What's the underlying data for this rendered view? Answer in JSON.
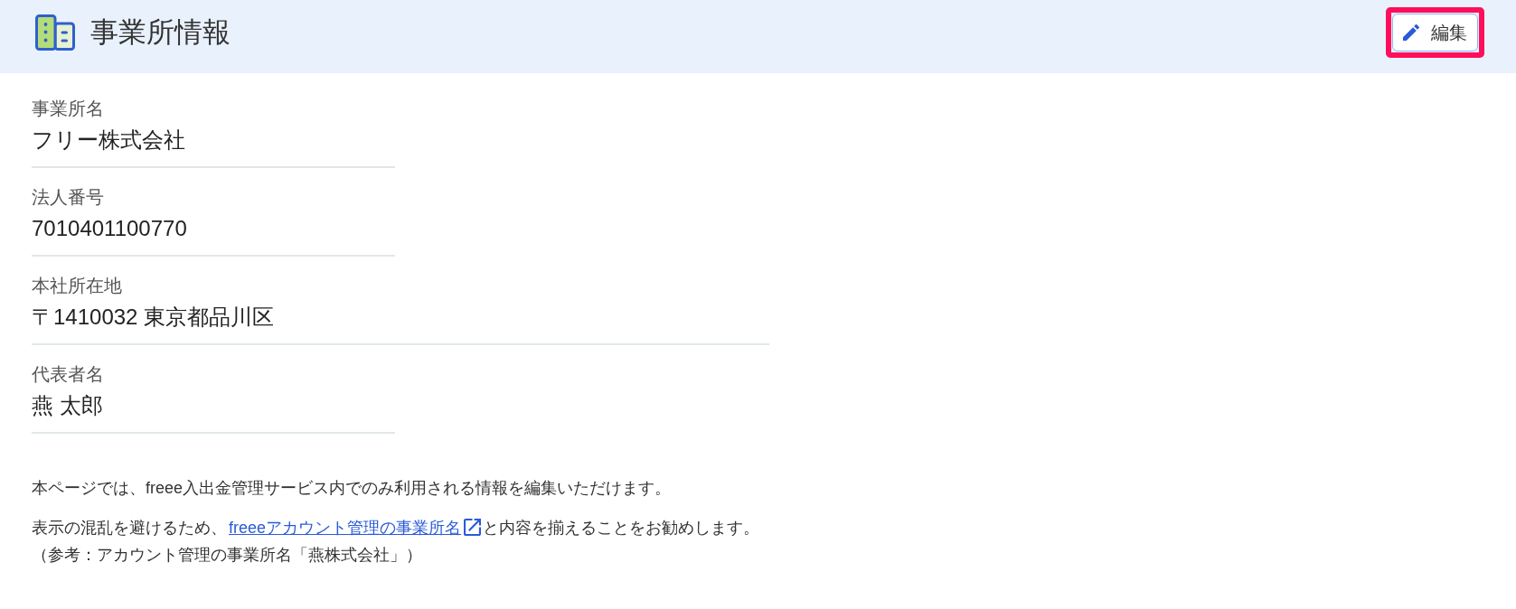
{
  "header": {
    "title": "事業所情報",
    "edit_button": {
      "label": "編集",
      "highlighted": true
    }
  },
  "fields": [
    {
      "kind": "text",
      "label": "事業所名",
      "value": "フリー株式会社"
    },
    {
      "kind": "text",
      "label": "法人番号",
      "value": "7010401100770"
    },
    {
      "kind": "address",
      "label": "本社所在地",
      "value": "〒1410032 東京都品川区"
    },
    {
      "kind": "text",
      "label": "代表者名",
      "value": "燕 太郎"
    }
  ],
  "notes": [
    {
      "lines": [
        {
          "kind": "text",
          "text": "本ページでは、freee入出金管理サービス内でのみ利用される情報を編集いただけます。"
        }
      ]
    },
    {
      "lines": [
        {
          "kind": "link",
          "before": "表示の混乱を避けるため、",
          "link": "freeeアカウント管理の事業所名",
          "after": "と内容を揃えることをお勧めします。"
        },
        {
          "kind": "text",
          "text": "（参考：アカウント管理の事業所名「燕株式会社」）"
        }
      ]
    }
  ]
}
